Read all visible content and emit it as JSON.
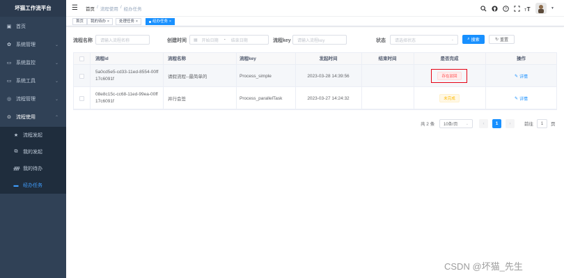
{
  "app": {
    "title": "坏猫工作流平台"
  },
  "sidebar": {
    "items": [
      {
        "label": "首页",
        "icon": "dashboard-icon"
      },
      {
        "label": "系统管理",
        "icon": "gear-icon"
      },
      {
        "label": "系统监控",
        "icon": "monitor-icon"
      },
      {
        "label": "系统工具",
        "icon": "tool-icon"
      },
      {
        "label": "流程管理",
        "icon": "flow-icon"
      },
      {
        "label": "流程使用",
        "icon": "flow-use-icon"
      }
    ],
    "sub_items": [
      {
        "label": "流程发起",
        "icon": "star-icon"
      },
      {
        "label": "我的发起",
        "icon": "share-icon"
      },
      {
        "label": "我的待办",
        "icon": "user-icon"
      },
      {
        "label": "经办任务",
        "icon": "dash-icon"
      }
    ]
  },
  "header": {
    "breadcrumb": [
      "首页",
      "/",
      "流程使用",
      "/",
      "经办任务"
    ]
  },
  "tags": [
    {
      "label": "首页"
    },
    {
      "label": "我的待办"
    },
    {
      "label": "处理任务"
    },
    {
      "label": "经办任务"
    }
  ],
  "search": {
    "name_label": "流程名称",
    "name_placeholder": "请输入流程名称",
    "time_label": "创建时间",
    "start_placeholder": "开始日期",
    "separator": "-",
    "end_placeholder": "结束日期",
    "key_label": "流程key",
    "key_placeholder": "请输入流程key",
    "status_label": "状态",
    "status_placeholder": "请选择状态",
    "search_btn": "搜索",
    "reset_btn": "重置"
  },
  "table": {
    "headers": [
      "流程id",
      "流程名称",
      "流程key",
      "发起时间",
      "结束时间",
      "是否完成",
      "操作"
    ],
    "rows": [
      {
        "id_line1": "5a0cd5e5-cd33-11ed-8554-00ff",
        "id_line2": "17c6091f",
        "name": "请假流程--最简单的",
        "key": "Process_simple",
        "start": "2023-03-28 14:39:56",
        "end": "",
        "status": "存在驳回",
        "action": "详情"
      },
      {
        "id_line1": "08e8c15c-cc68-11ed-99ea-00ff",
        "id_line2": "17c6091f",
        "name": "并行会签",
        "key": "Process_parallelTask",
        "start": "2023-03-27 14:24:32",
        "end": "",
        "status": "未完成",
        "action": "详情"
      }
    ]
  },
  "pagination": {
    "total": "共 2 条",
    "page_size": "10条/页",
    "current_page": "1",
    "goto_label": "前往",
    "goto_value": "1",
    "page_suffix": "页",
    "prev": "‹",
    "next": "›"
  },
  "watermark": "CSDN @坏猫_先生",
  "colors": {
    "sidebar_bg": "#304156",
    "primary": "#1890ff",
    "danger": "#ff4949",
    "warning": "#ffba00",
    "highlight": "#e60012"
  }
}
